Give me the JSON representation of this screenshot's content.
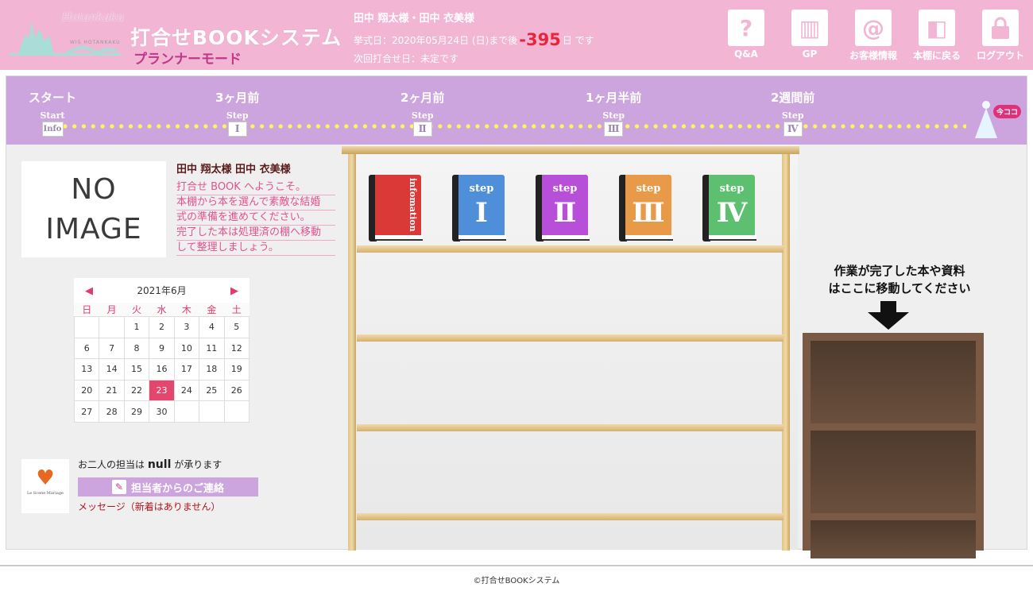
{
  "header": {
    "logo_text": "Hotankaku",
    "logo_sub": "WIS HOTANKAKU",
    "app_title": "打合せBOOKシステム",
    "mode": "プランナーモード",
    "names": "田中 翔太様・田中 衣美様",
    "wedding_prefix": "挙式日：2020年05月24日 (日)まで後",
    "days_remaining": "-395",
    "days_suffix": "日 です",
    "next_meeting": "次回打合せ日：未定です",
    "buttons": [
      {
        "label": "Q&A",
        "icon": "question-book-icon"
      },
      {
        "label": "GP",
        "icon": "gp-book-icon"
      },
      {
        "label": "お客様情報",
        "icon": "at-sign-icon"
      },
      {
        "label": "本棚に戻る",
        "icon": "bookshelf-return-icon"
      },
      {
        "label": "ログアウト",
        "icon": "lock-icon"
      }
    ]
  },
  "timeline": {
    "items": [
      {
        "title": "スタート",
        "step": "Start",
        "box": "Info"
      },
      {
        "title": "3ヶ月前",
        "step": "Step",
        "box": "Ⅰ"
      },
      {
        "title": "2ヶ月前",
        "step": "Step",
        "box": "Ⅱ"
      },
      {
        "title": "1ヶ月半前",
        "step": "Step",
        "box": "Ⅲ"
      },
      {
        "title": "2週間前",
        "step": "Step",
        "box": "Ⅳ"
      }
    ],
    "current_marker": "今ココ"
  },
  "profile": {
    "no_image_line1": "NO",
    "no_image_line2": "IMAGE",
    "couple": "田中 翔太様 田中 衣美様",
    "welcome": [
      "打合せ BOOK へようこそ。",
      "本棚から本を選んで素敵な結婚",
      "式の準備を進めてください。",
      "完了した本は処理済の棚へ移動",
      "して整理しましょう。"
    ]
  },
  "calendar": {
    "title": "2021年6月",
    "weekdays": [
      "日",
      "月",
      "火",
      "水",
      "木",
      "金",
      "土"
    ],
    "weeks": [
      [
        "",
        "",
        "1",
        "2",
        "3",
        "4",
        "5"
      ],
      [
        "6",
        "7",
        "8",
        "9",
        "10",
        "11",
        "12"
      ],
      [
        "13",
        "14",
        "15",
        "16",
        "17",
        "18",
        "19"
      ],
      [
        "20",
        "21",
        "22",
        "23",
        "24",
        "25",
        "26"
      ],
      [
        "27",
        "28",
        "29",
        "30",
        "",
        "",
        ""
      ]
    ],
    "today": "23"
  },
  "staff": {
    "partner_name": "Le Scene Mariage",
    "prefix": "お二人の担当は",
    "name": "null",
    "suffix": "が承ります",
    "contact_button": "担当者からのご連絡",
    "message_status": "メッセージ（新着はありません）"
  },
  "books": [
    {
      "label": "infomation",
      "color": "#d93a38",
      "type": "info"
    },
    {
      "label": "step",
      "numeral": "Ⅰ",
      "color": "#4f8ed8"
    },
    {
      "label": "step",
      "numeral": "Ⅱ",
      "color": "#b84fd8"
    },
    {
      "label": "step",
      "numeral": "Ⅲ",
      "color": "#e89a48"
    },
    {
      "label": "step",
      "numeral": "Ⅳ",
      "color": "#5cc070"
    }
  ],
  "done_shelf": {
    "line1": "作業が完了した本や資料",
    "line2": "はここに移動してください"
  },
  "footer": {
    "copyright": "©打合せBOOKシステム"
  },
  "colors": {
    "header_bg": "#f2b5d4",
    "timeline_bg": "#cda5de",
    "accent_pink": "#e4466e",
    "days_red": "#e8253a"
  }
}
